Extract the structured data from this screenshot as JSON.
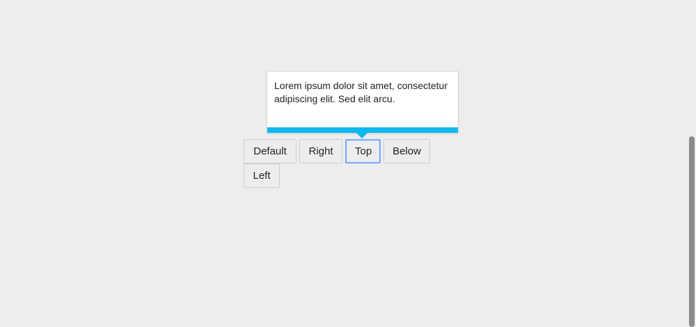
{
  "tooltip": {
    "text": "Lorem ipsum dolor sit amet, consectetur adipiscing elit. Sed elit arcu."
  },
  "buttons": {
    "default": "Default",
    "right": "Right",
    "top": "Top",
    "below": "Below",
    "left": "Left"
  },
  "colors": {
    "background": "#ededed",
    "tooltip_accent": "#10b8f0",
    "focus_ring": "#76a9ff"
  }
}
